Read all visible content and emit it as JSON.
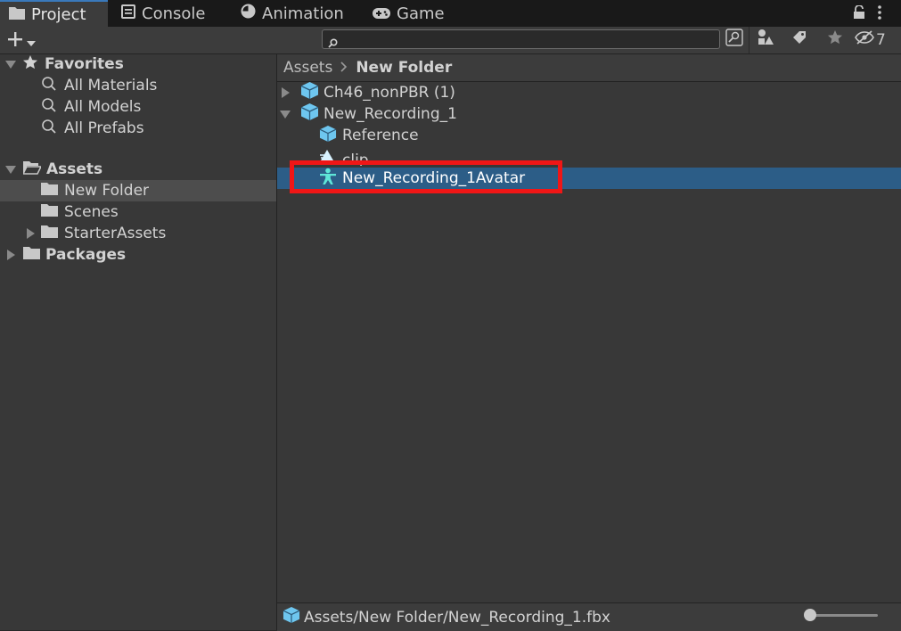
{
  "tabs": [
    {
      "label": "Project",
      "icon": "folder-icon",
      "active": true
    },
    {
      "label": "Console",
      "icon": "console-icon",
      "active": false
    },
    {
      "label": "Animation",
      "icon": "animation-clock-icon",
      "active": false
    },
    {
      "label": "Game",
      "icon": "gamepad-icon",
      "active": false
    }
  ],
  "toolbar": {
    "search_value": "",
    "hidden_count": "7"
  },
  "favorites": {
    "label": "Favorites",
    "items": [
      "All Materials",
      "All Models",
      "All Prefabs"
    ]
  },
  "assets_tree": {
    "label": "Assets",
    "children": [
      {
        "label": "New Folder",
        "selected": true
      },
      {
        "label": "Scenes"
      },
      {
        "label": "StarterAssets"
      }
    ],
    "packages_label": "Packages"
  },
  "breadcrumb": {
    "root": "Assets",
    "current": "New Folder"
  },
  "content": {
    "items": [
      {
        "label": "Ch46_nonPBR (1)"
      },
      {
        "label": "New_Recording_1"
      },
      {
        "label": "Reference"
      },
      {
        "label": "clip"
      },
      {
        "label": "New_Recording_1Avatar",
        "selected": true
      }
    ]
  },
  "status": {
    "path": "Assets/New Folder/New_Recording_1.fbx"
  },
  "colors": {
    "accent_tab": "#3a79bb",
    "selection": "#2c5d87",
    "highlight_box": "#f01616",
    "model_icon": "#6ec6ef"
  }
}
